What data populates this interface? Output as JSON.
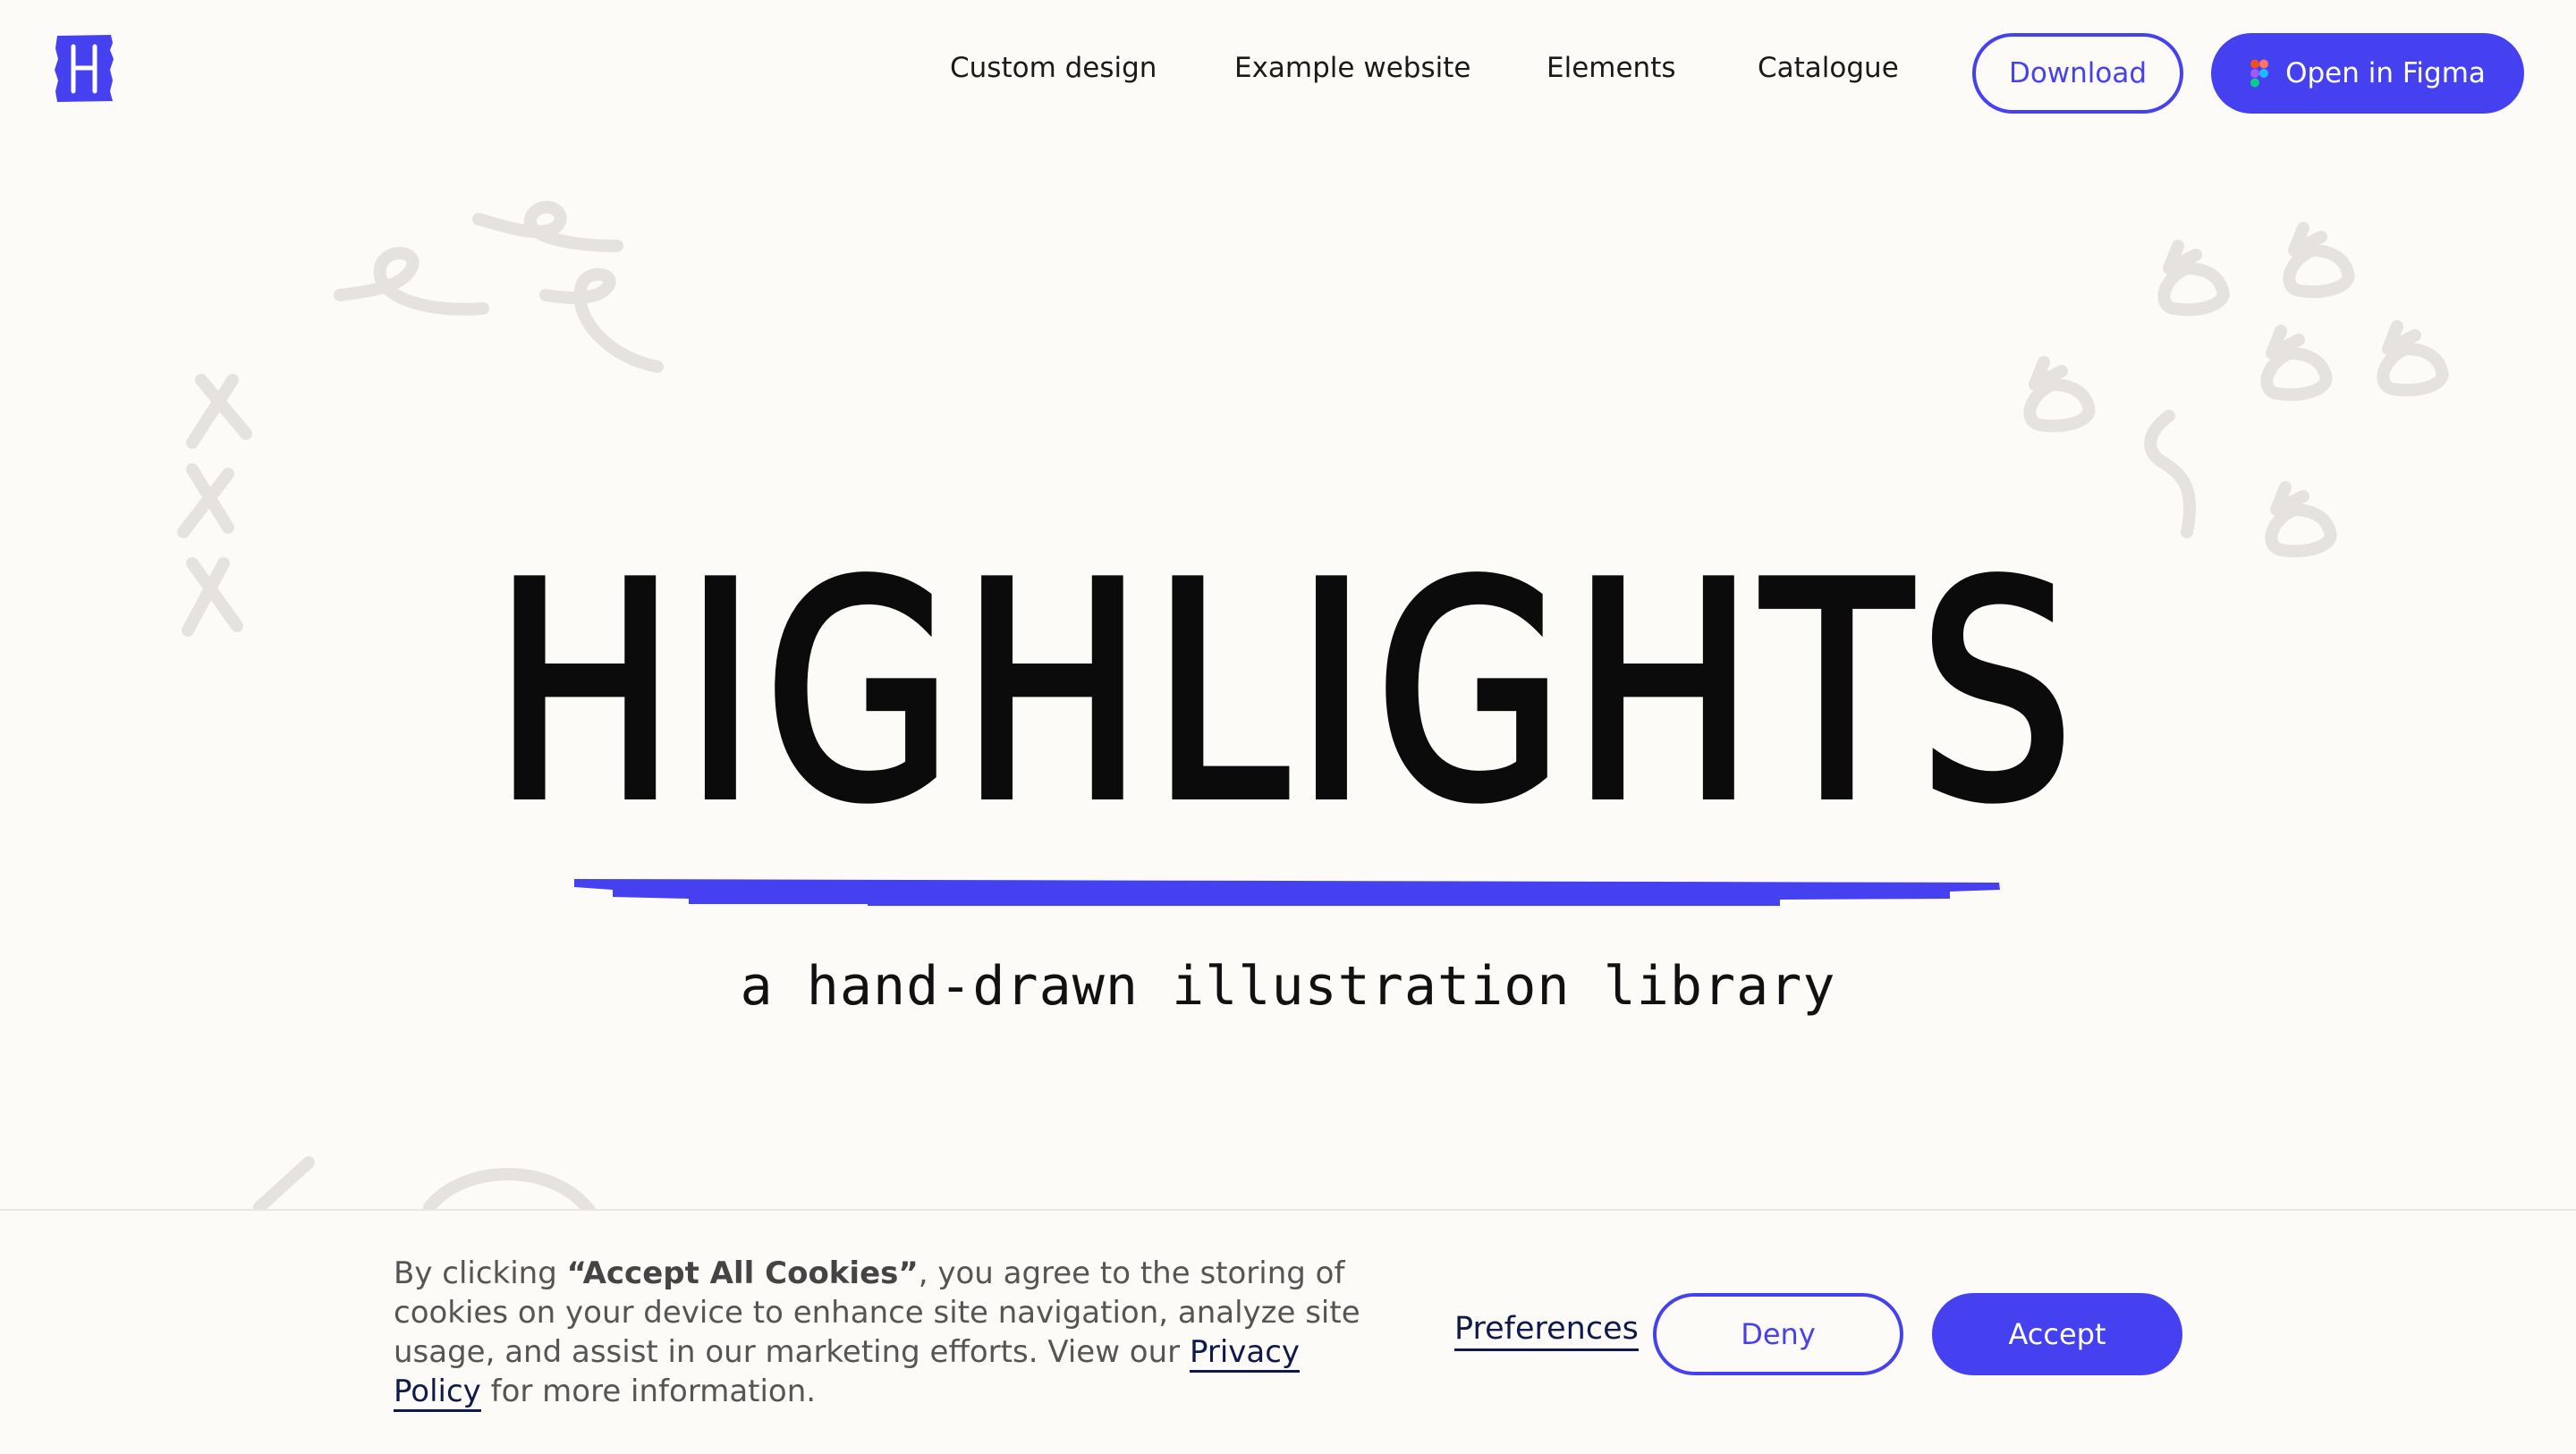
{
  "nav": {
    "links": [
      "Custom design",
      "Example website",
      "Elements",
      "Catalogue"
    ],
    "download_label": "Download",
    "figma_label": "Open in Figma"
  },
  "hero": {
    "title": "HIGHLIGHTS",
    "subtitle": "a hand-drawn illustration library"
  },
  "cookie": {
    "text_before": "By clicking ",
    "text_bold": "“Accept All Cookies”",
    "text_middle": ", you agree to the storing of cookies on your device to enhance site navigation, analyze site usage, and assist in our marketing efforts. View our ",
    "privacy_link": "Privacy Policy",
    "text_after": " for more information.",
    "preferences_label": "Preferences",
    "deny_label": "Deny",
    "accept_label": "Accept"
  },
  "colors": {
    "accent": "#4541f1",
    "background": "#fdfbf8",
    "doodle": "#e6e3df",
    "link": "#0f1a4a"
  },
  "icons": {
    "logo": "h-letter-logo",
    "figma": "figma-icon"
  }
}
